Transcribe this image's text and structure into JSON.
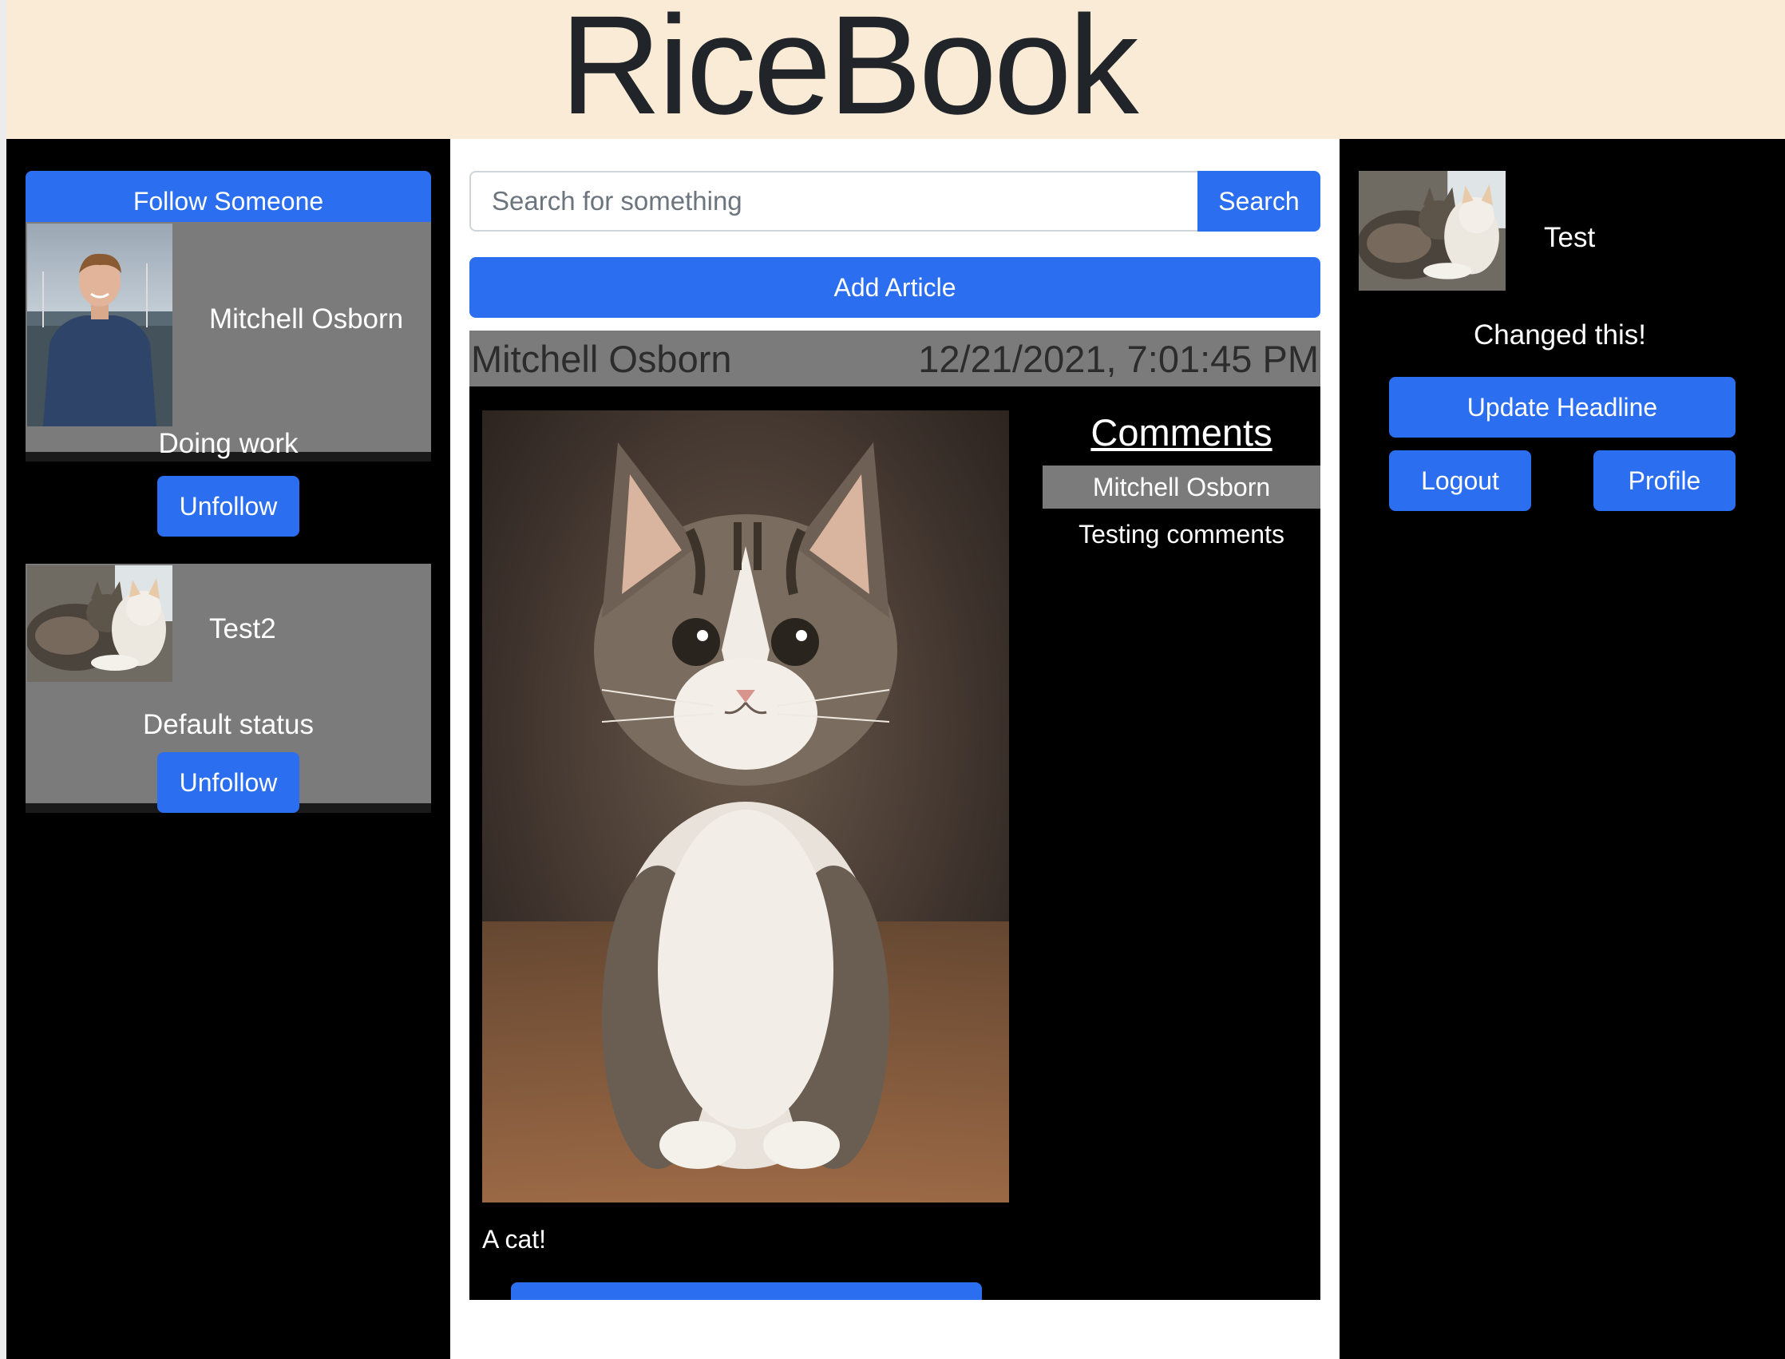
{
  "app": {
    "brand": "RiceBook"
  },
  "sidebar_left": {
    "follow_button": "Follow Someone",
    "following": [
      {
        "name": "Mitchell Osborn",
        "status": "Doing work",
        "unfollow_label": "Unfollow",
        "avatar": "person-photo"
      },
      {
        "name": "Test2",
        "status": "Default status",
        "unfollow_label": "Unfollow",
        "avatar": "cats-photo"
      }
    ]
  },
  "main": {
    "search": {
      "placeholder": "Search for something",
      "value": "",
      "button_label": "Search"
    },
    "add_article_label": "Add Article",
    "articles": [
      {
        "author": "Mitchell Osborn",
        "timestamp": "12/21/2021, 7:01:45 PM",
        "text": "A cat!",
        "image": "kitten-photo",
        "comments_title": "Comments",
        "comments": [
          {
            "author": "Mitchell Osborn",
            "text": "Testing comments"
          }
        ]
      }
    ]
  },
  "sidebar_right": {
    "user_name": "Test",
    "headline": "Changed this!",
    "update_headline_label": "Update Headline",
    "logout_label": "Logout",
    "profile_label": "Profile",
    "avatar": "cats-photo"
  },
  "colors": {
    "header_bg": "#faebd7",
    "accent": "#2b6ff0",
    "card_bg": "#7b7b7b",
    "panel_bg": "#000000"
  }
}
